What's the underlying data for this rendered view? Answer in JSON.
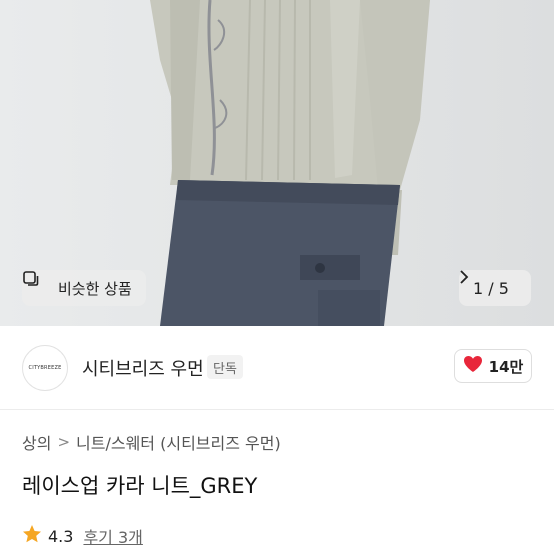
{
  "gallery": {
    "similar_label": "비슷한 상품",
    "page_indicator": "1 / 5",
    "next_icon": "chevron-right-icon",
    "similar_icon": "copy-icon"
  },
  "brand": {
    "logo_text": "CITYBREEZE",
    "name": "시티브리즈 우먼",
    "badge": "단독"
  },
  "like": {
    "count": "14만",
    "icon": "heart-icon",
    "color": "#e8263a"
  },
  "breadcrumb": {
    "items": [
      "상의",
      "니트/스웨터 (시티브리즈 우먼)"
    ],
    "separator": ">"
  },
  "product": {
    "title": "레이스업 카라 니트_GREY"
  },
  "rating": {
    "score": "4.3",
    "reviews": "후기 3개",
    "star_color": "#f5a623"
  }
}
